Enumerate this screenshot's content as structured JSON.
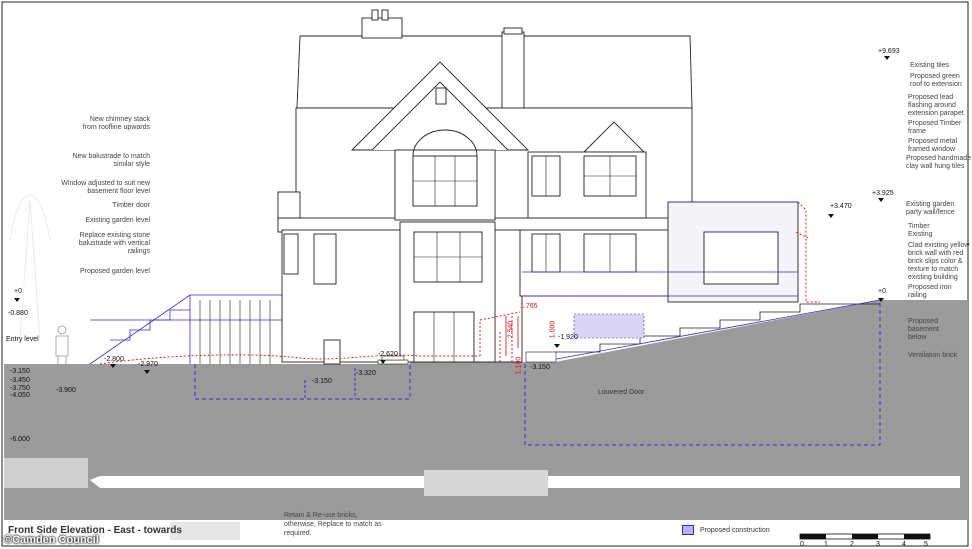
{
  "title": "Front Side Elevation - East - towards",
  "credit": "©Camden Council",
  "notes_left": [
    "New chimney stack\nfrom roofline upwards",
    "New balustrade to match\nsimilar style",
    "Window adjusted to suit new\nbasement floor level",
    "Timber door",
    "Existing garden level",
    "Replace existing stone\nbalustrade with vertical\nrailings",
    "Proposed garden level"
  ],
  "notes_right": [
    "Existing tiles",
    "Proposed green\nroof to extension",
    "Proposed lead\nflashing around\nextension parapet",
    "Proposed Timber\nframe",
    "Proposed metal\nframed window",
    "Proposed handmade\nclay wall hung tiles",
    "Existing garden\nparty wall/fence",
    "Timber\nExisting",
    "Clad existing yellow\nbrick wall with red\nbrick slips color &\ntexture to match\nexisting building",
    "Proposed iron\nrailing",
    "Proposed\nbasement\nbelow",
    "Ventilation brick"
  ],
  "levels_left": [
    "+0",
    "-0.880",
    "-3.150",
    "-3.450",
    "-3.750",
    "-4.050",
    "-3.900",
    "-6.000"
  ],
  "levels_mid": [
    "-2.800",
    "-2.970",
    "-2.620",
    "-3.320",
    "-3.150",
    "-3.150",
    "-1.920"
  ],
  "levels_right": [
    "+9.693",
    "+3.925",
    "+3.470",
    "+0"
  ],
  "red_dims": [
    "1.765",
    "2.540",
    "1.100",
    "1.000"
  ],
  "entry_level": "Entry level",
  "louvered_door": "Louvered Door",
  "retain_note": "Retain & Re-use bricks,\notherwise, Replace to match as\nrequired.",
  "legend_label": "Proposed construction",
  "scale_ticks": [
    "0",
    "1",
    "2",
    "3",
    "4",
    "5"
  ],
  "colors": {
    "ground": "#9b9b9b",
    "proposed": "#3a2bd0",
    "red": "#d11111",
    "line": "#222222"
  }
}
